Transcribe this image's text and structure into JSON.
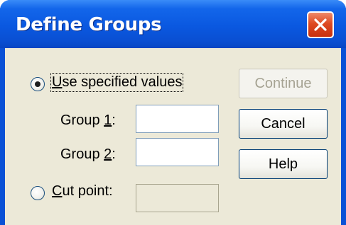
{
  "dialog": {
    "title": "Define Groups",
    "close_icon": "close-icon"
  },
  "options": {
    "use_specified": {
      "label_accel": "U",
      "label_rest": "se specified values",
      "selected": true
    },
    "group1": {
      "label_pre": "Group ",
      "label_accel": "1",
      "label_post": ":",
      "value": ""
    },
    "group2": {
      "label_pre": "Group ",
      "label_accel": "2",
      "label_post": ":",
      "value": ""
    },
    "cut_point": {
      "label_accel": "C",
      "label_rest": "ut point:",
      "selected": false,
      "value": ""
    }
  },
  "buttons": {
    "continue": {
      "label": "Continue",
      "enabled": false
    },
    "cancel": {
      "label": "Cancel",
      "enabled": true
    },
    "help": {
      "label": "Help",
      "enabled": true
    }
  },
  "colors": {
    "titlebar": "#0a51d6",
    "client_bg": "#ece9d8",
    "close_button": "#de4a22",
    "disabled_text": "#a6a393"
  }
}
